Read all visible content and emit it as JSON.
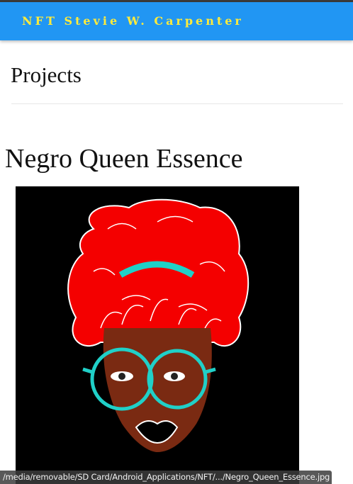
{
  "app": {
    "title": "NFT Stevie W. Carpenter"
  },
  "section": {
    "title": "Projects"
  },
  "project": {
    "title": "Negro Queen Essence",
    "image_alt": "Negro Queen Essence artwork"
  },
  "status": {
    "url": "/media/removable/SD Card/Android_Applications/NFT/.../Negro_Queen_Essence.jpg"
  },
  "colors": {
    "appbar": "#2196f3",
    "title_text": "#ffeb3b"
  }
}
